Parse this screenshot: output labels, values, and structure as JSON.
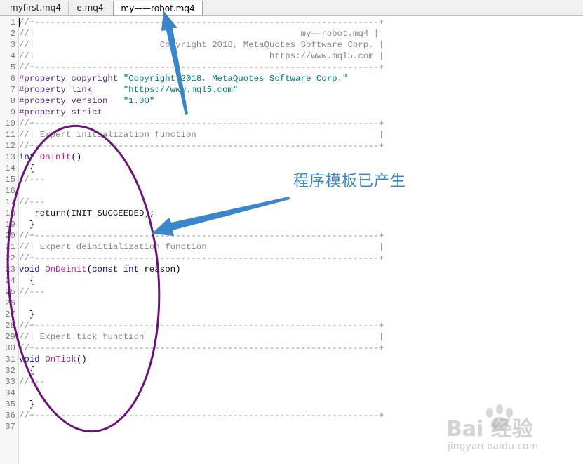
{
  "tabs": [
    {
      "label": "myfirst.mq4",
      "active": false
    },
    {
      "label": "e.mq4",
      "active": false
    },
    {
      "label": "my——robot.mq4",
      "active": true
    }
  ],
  "editor": {
    "lines": [
      {
        "n": "1",
        "segs": [
          [
            "cm",
            "//+------------------------------------------------------------------+"
          ]
        ]
      },
      {
        "n": "2",
        "segs": [
          [
            "cm",
            "//|                                                   my——robot.mq4 |"
          ]
        ]
      },
      {
        "n": "3",
        "segs": [
          [
            "cm",
            "//|                        Copyright 2018, MetaQuotes Software Corp. |"
          ]
        ]
      },
      {
        "n": "4",
        "segs": [
          [
            "cm",
            "//|                                             https://www.mql5.com |"
          ]
        ]
      },
      {
        "n": "5",
        "segs": [
          [
            "cm",
            "//+------------------------------------------------------------------+"
          ]
        ]
      },
      {
        "n": "6",
        "segs": [
          [
            "pp",
            "#property copyright "
          ],
          [
            "str",
            "\"Copyright 2018, MetaQuotes Software Corp.\""
          ]
        ]
      },
      {
        "n": "7",
        "segs": [
          [
            "pp",
            "#property link      "
          ],
          [
            "str",
            "\"https://www.mql5.com\""
          ]
        ]
      },
      {
        "n": "8",
        "segs": [
          [
            "pp",
            "#property version   "
          ],
          [
            "str",
            "\"1.00\""
          ]
        ]
      },
      {
        "n": "9",
        "segs": [
          [
            "pp",
            "#property strict"
          ]
        ]
      },
      {
        "n": "10",
        "segs": [
          [
            "cm",
            "//+------------------------------------------------------------------+"
          ]
        ]
      },
      {
        "n": "11",
        "segs": [
          [
            "cm",
            "//| Expert initialization function                                   |"
          ]
        ]
      },
      {
        "n": "12",
        "segs": [
          [
            "cm",
            "//+------------------------------------------------------------------+"
          ]
        ]
      },
      {
        "n": "13",
        "segs": [
          [
            "kw",
            "int "
          ],
          [
            "fn",
            "OnInit"
          ],
          [
            "",
            "()"
          ]
        ]
      },
      {
        "n": "14",
        "segs": [
          [
            "",
            "  {"
          ]
        ]
      },
      {
        "n": "15",
        "segs": [
          [
            "cm",
            "//---"
          ]
        ]
      },
      {
        "n": "16",
        "segs": [
          [
            "",
            ""
          ]
        ]
      },
      {
        "n": "17",
        "segs": [
          [
            "cm",
            "//---"
          ]
        ]
      },
      {
        "n": "18",
        "segs": [
          [
            "",
            "   return(INIT_SUCCEEDED);"
          ]
        ]
      },
      {
        "n": "19",
        "segs": [
          [
            "",
            "  }"
          ]
        ]
      },
      {
        "n": "20",
        "segs": [
          [
            "cm",
            "//+------------------------------------------------------------------+"
          ]
        ]
      },
      {
        "n": "21",
        "segs": [
          [
            "cm",
            "//| Expert deinitialization function                                 |"
          ]
        ]
      },
      {
        "n": "22",
        "segs": [
          [
            "cm",
            "//+------------------------------------------------------------------+"
          ]
        ]
      },
      {
        "n": "23",
        "segs": [
          [
            "kw",
            "void "
          ],
          [
            "fn",
            "OnDeinit"
          ],
          [
            "",
            "("
          ],
          [
            "kw",
            "const int "
          ],
          [
            "",
            "reason)"
          ]
        ]
      },
      {
        "n": "24",
        "segs": [
          [
            "",
            "  {"
          ]
        ]
      },
      {
        "n": "25",
        "segs": [
          [
            "cm",
            "//---"
          ]
        ]
      },
      {
        "n": "26",
        "segs": [
          [
            "",
            ""
          ]
        ]
      },
      {
        "n": "27",
        "segs": [
          [
            "",
            "  }"
          ]
        ]
      },
      {
        "n": "28",
        "segs": [
          [
            "cm",
            "//+------------------------------------------------------------------+"
          ]
        ]
      },
      {
        "n": "29",
        "segs": [
          [
            "cm",
            "//| Expert tick function                                             |"
          ]
        ]
      },
      {
        "n": "30",
        "segs": [
          [
            "cm",
            "//+------------------------------------------------------------------+"
          ]
        ]
      },
      {
        "n": "31",
        "segs": [
          [
            "kw",
            "void "
          ],
          [
            "fn",
            "OnTick"
          ],
          [
            "",
            "()"
          ]
        ]
      },
      {
        "n": "32",
        "segs": [
          [
            "",
            "  {"
          ]
        ]
      },
      {
        "n": "33",
        "segs": [
          [
            "cm",
            "//---"
          ]
        ]
      },
      {
        "n": "34",
        "segs": [
          [
            "",
            ""
          ]
        ]
      },
      {
        "n": "35",
        "segs": [
          [
            "",
            "  }"
          ]
        ]
      },
      {
        "n": "36",
        "segs": [
          [
            "cm",
            "//+------------------------------------------------------------------+"
          ]
        ]
      },
      {
        "n": "37",
        "segs": [
          [
            "",
            ""
          ]
        ]
      }
    ]
  },
  "annotation": {
    "caption": "程序模板已产生",
    "arrow_color": "#3a86c8",
    "ellipse_color": "#6a1478"
  },
  "watermark": {
    "brand": "Bai  经验",
    "url": "jingyan.baidu.com"
  },
  "colors": {
    "comment": "#8a8a8a",
    "keyword": "#0000d0",
    "function": "#b8238a",
    "string": "#007d7d",
    "preprocessor": "#5a2a88"
  }
}
